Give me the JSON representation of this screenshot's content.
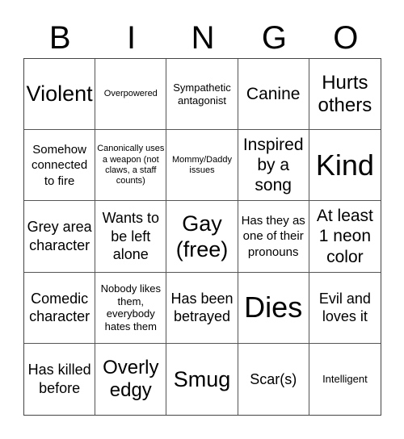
{
  "header": {
    "letters": [
      "B",
      "I",
      "N",
      "G",
      "O"
    ]
  },
  "cells": [
    "Violent",
    "Overpowered",
    "Sympathetic antagonist",
    "Canine",
    "Hurts others",
    "Somehow connected to fire",
    "Canonically uses a weapon (not claws, a staff counts)",
    "Mommy/Daddy issues",
    "Inspired by a song",
    "Kind",
    "Grey area character",
    "Wants to be left alone",
    "Gay (free)",
    "Has they as one of their pronouns",
    "At least 1 neon color",
    "Comedic character",
    "Nobody likes them, everybody hates them",
    "Has been betrayed",
    "Dies",
    "Evil and loves it",
    "Has killed before",
    "Overly edgy",
    "Smug",
    "Scar(s)",
    "Intelligent"
  ]
}
